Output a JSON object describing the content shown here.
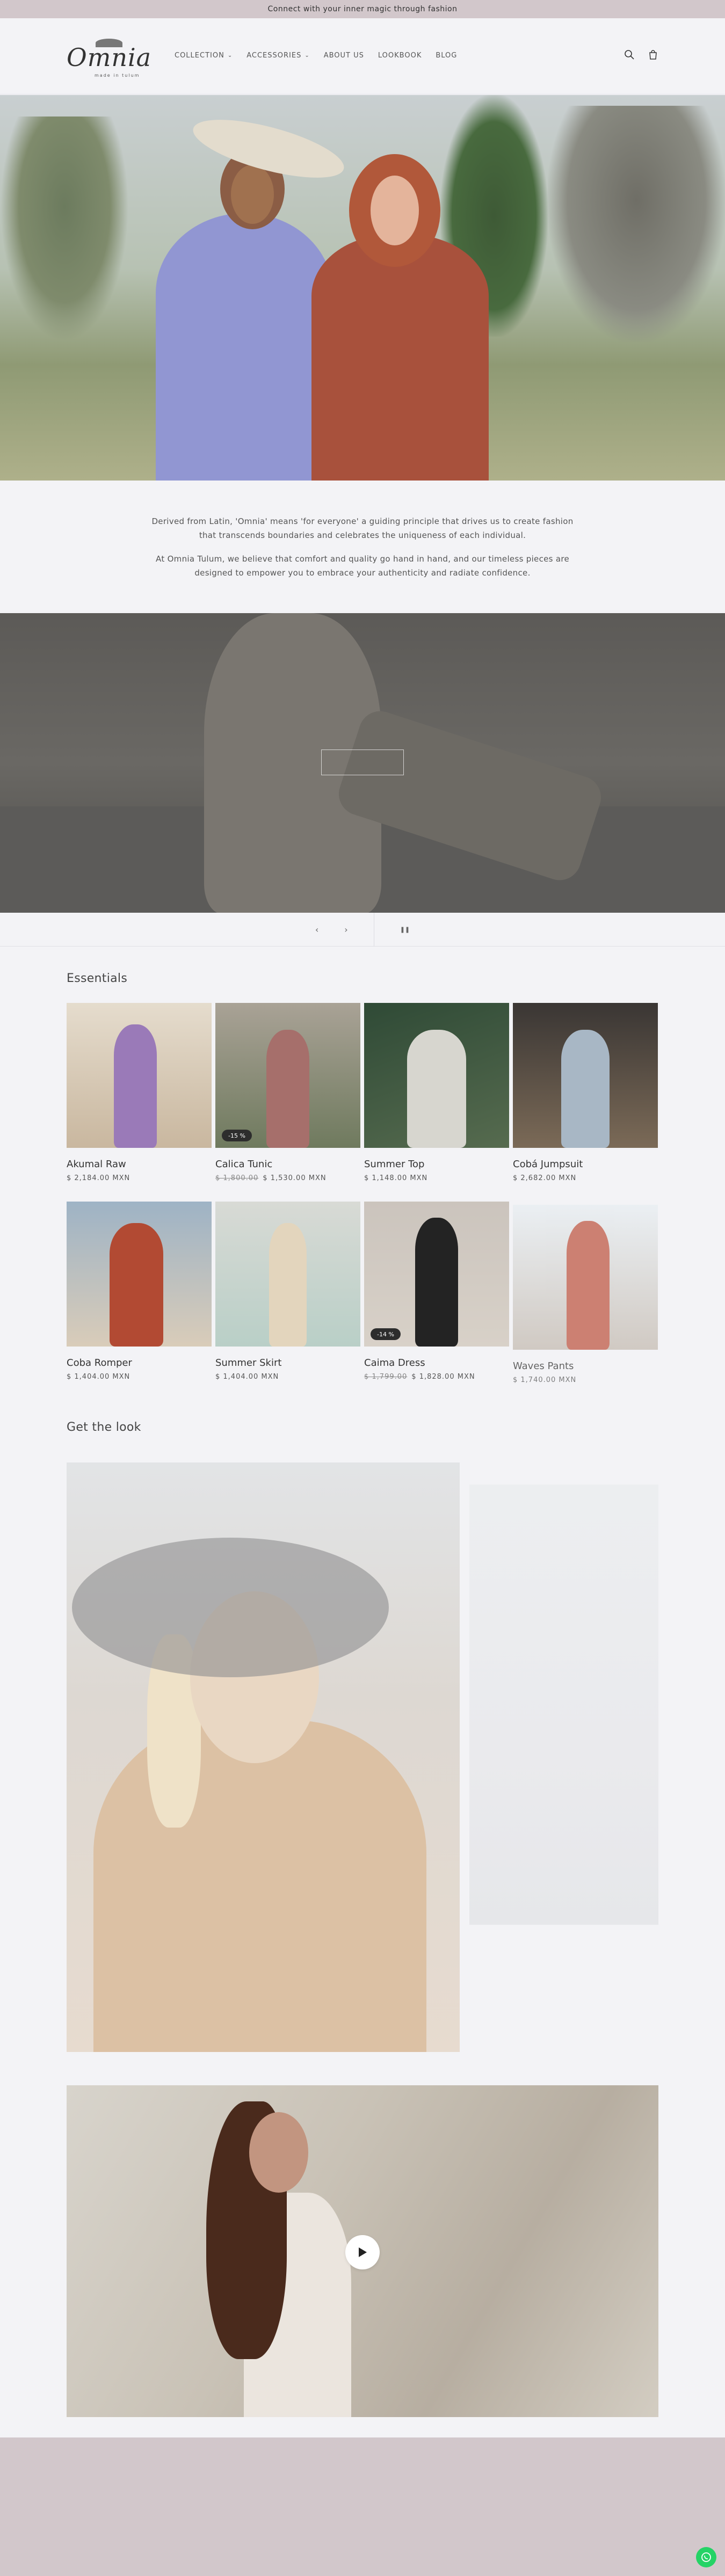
{
  "announcement": "Connect with your inner magic through fashion",
  "logo": {
    "word": "Omnia",
    "sub": "made in tulum"
  },
  "nav": [
    {
      "label": "COLLECTION",
      "dropdown": true
    },
    {
      "label": "ACCESSORIES",
      "dropdown": true
    },
    {
      "label": "ABOUT US",
      "dropdown": false
    },
    {
      "label": "LOOKBOOK",
      "dropdown": false
    },
    {
      "label": "BLOG",
      "dropdown": false
    }
  ],
  "intro": {
    "p1": "Derived from Latin, 'Omnia' means 'for everyone' a guiding principle that drives us to create fashion that transcends boundaries and celebrates the uniqueness of each individual.",
    "p2": "At Omnia Tulum, we believe that comfort and quality go hand in hand, and our timeless pieces are designed to empower you to embrace your authenticity and radiate confidence."
  },
  "slideshow": {
    "prev": "‹",
    "next": "›",
    "pause": "❚❚"
  },
  "essentials": {
    "title": "Essentials",
    "products": [
      {
        "name": "Akumal Raw",
        "price": "$ 2,184.00 MXN",
        "old_price": "",
        "badge": ""
      },
      {
        "name": "Calica Tunic",
        "price": "$ 1,530.00 MXN",
        "old_price": "$ 1,800.00",
        "badge": "-15 %"
      },
      {
        "name": "Summer Top",
        "price": "$ 1,148.00 MXN",
        "old_price": "",
        "badge": ""
      },
      {
        "name": "Cobá Jumpsuit",
        "price": "$ 2,682.00 MXN",
        "old_price": "",
        "badge": ""
      },
      {
        "name": "Coba Romper",
        "price": "$ 1,404.00 MXN",
        "old_price": "",
        "badge": ""
      },
      {
        "name": "Summer Skirt",
        "price": "$ 1,404.00 MXN",
        "old_price": "",
        "badge": ""
      },
      {
        "name": "Caima Dress",
        "price": "$ 1,828.00 MXN",
        "old_price": "$ 1,799.00",
        "badge": "-14 %"
      },
      {
        "name": "Waves Pants",
        "price": "$ 1,740.00 MXN",
        "old_price": "",
        "badge": ""
      }
    ]
  },
  "get_the_look": {
    "title": "Get the look"
  },
  "colors": {
    "announcement_bg": "#d2c7cb",
    "page_bg": "#f3f3f6",
    "whatsapp": "#25d366"
  }
}
